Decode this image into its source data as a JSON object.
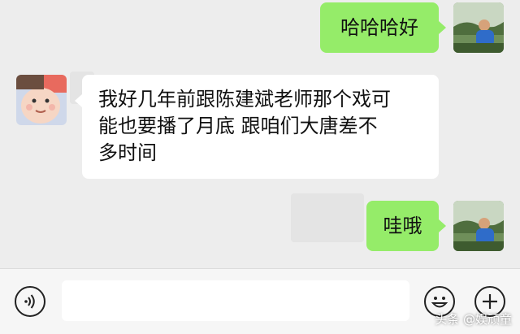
{
  "messages": [
    {
      "side": "right",
      "text": "哈哈哈好"
    },
    {
      "side": "left",
      "lines": [
        "我好几年前跟陈建斌老师那个戏可",
        "能也要播了月底 跟咱们大唐差不",
        "多时间"
      ]
    },
    {
      "side": "right",
      "text": "哇哦"
    }
  ],
  "icons": {
    "voice": "voice-icon",
    "emoji": "emoji-icon",
    "add": "plus-icon"
  },
  "watermark": "头条 @娱顽童",
  "colors": {
    "chat_bg": "#ededed",
    "sent_bubble": "#95ec69",
    "received_bubble": "#ffffff"
  }
}
